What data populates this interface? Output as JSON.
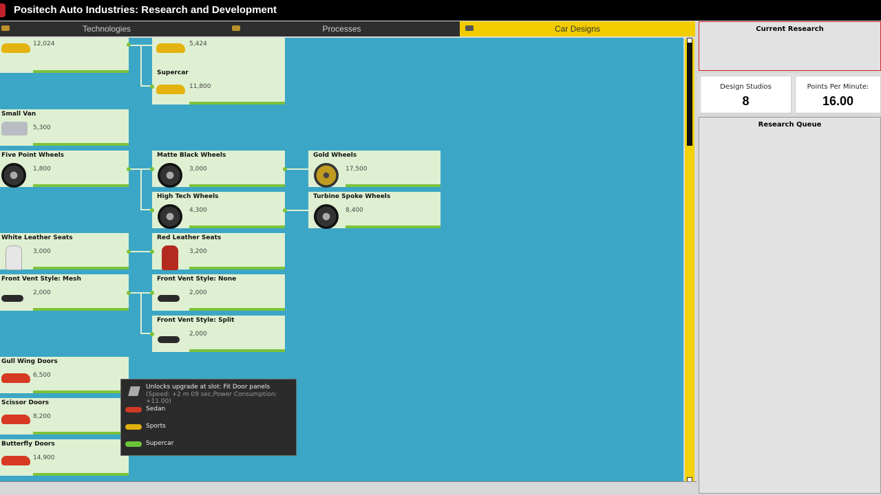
{
  "app": {
    "title": "Positech Auto Industries: Research and Development"
  },
  "tabs": [
    {
      "label": "Technologies",
      "icon": "gear-icon"
    },
    {
      "label": "Processes",
      "icon": "wrench-icon"
    },
    {
      "label": "Car Designs",
      "icon": "car-icon",
      "active": true
    }
  ],
  "nodes": {
    "top_left": {
      "name": "",
      "cost": "12,024"
    },
    "top_mid": {
      "name": "",
      "cost": "5,424"
    },
    "supercar": {
      "name": "Supercar",
      "cost": "11,800"
    },
    "small_van": {
      "name": "Small Van",
      "cost": "5,300"
    },
    "five_point": {
      "name": "Five Point Wheels",
      "cost": "1,800"
    },
    "matte_black": {
      "name": "Matte Black Wheels",
      "cost": "3,000"
    },
    "gold_wheels": {
      "name": "Gold Wheels",
      "cost": "17,500"
    },
    "high_tech": {
      "name": "High Tech Wheels",
      "cost": "4,300"
    },
    "turbine": {
      "name": "Turbine Spoke Wheels",
      "cost": "8,400"
    },
    "white_leather": {
      "name": "White Leather Seats",
      "cost": "3,000"
    },
    "red_leather": {
      "name": "Red Leather Seats",
      "cost": "3,200"
    },
    "vent_mesh": {
      "name": "Front Vent Style: Mesh",
      "cost": "2,000"
    },
    "vent_none": {
      "name": "Front Vent Style: None",
      "cost": "2,000"
    },
    "vent_split": {
      "name": "Front Vent Style: Split",
      "cost": "2,000"
    },
    "gull_wing": {
      "name": "Gull Wing Doors",
      "cost": "6,500"
    },
    "scissor": {
      "name": "Scissor Doors",
      "cost": "8,200"
    },
    "butterfly": {
      "name": "Butterfly Doors",
      "cost": "14,900"
    }
  },
  "tooltip": {
    "line1": "Unlocks upgrade at slot: Fit Door panels",
    "line2": "(Speed: +2 m 09 sec,Power Consumption: +11.00)",
    "items": [
      {
        "label": "Sedan",
        "color": "#d03a25"
      },
      {
        "label": "Sports",
        "color": "#e0b00f"
      },
      {
        "label": "Supercar",
        "color": "#6cc43a"
      }
    ]
  },
  "panels": {
    "current_research": "Current Research",
    "design_studios_label": "Design Studios",
    "design_studios_value": "8",
    "points_label": "Points Per Minute:",
    "points_value": "16.00",
    "queue_title": "Research Queue"
  },
  "colors": {
    "canvas": "#3ba6c6",
    "node_bg": "#dff0d2",
    "progress": "#7cc23a",
    "active_tab": "#f2cc00"
  }
}
